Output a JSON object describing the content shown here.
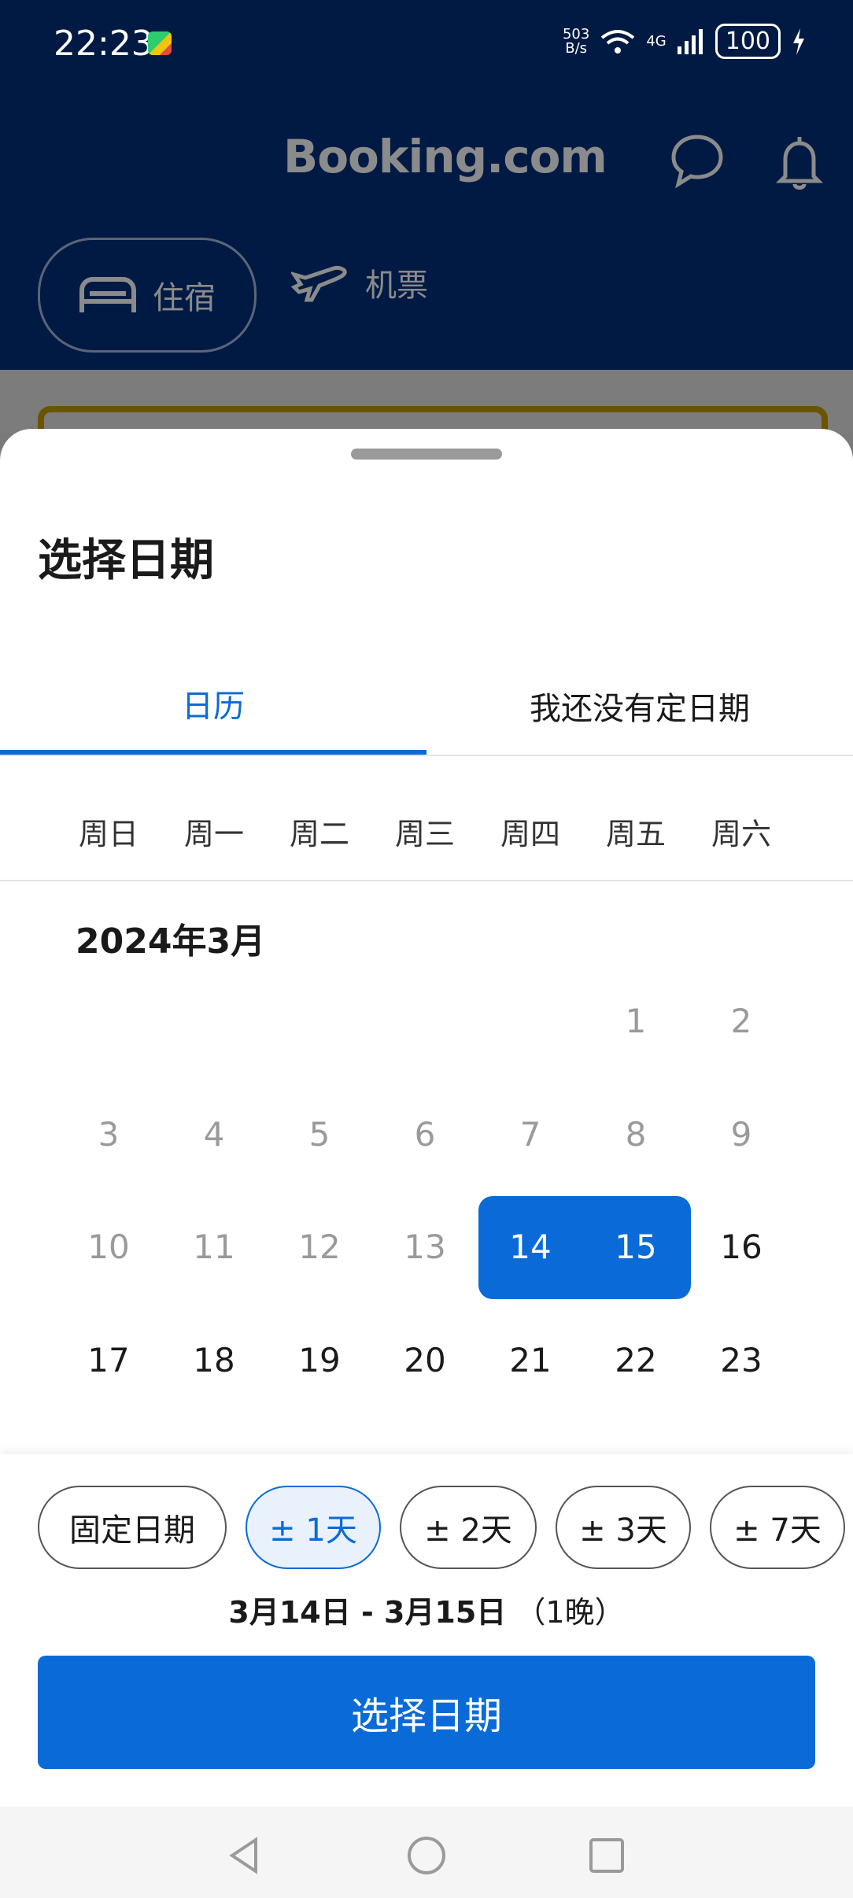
{
  "status": {
    "time": "22:23",
    "net_speed": "503\nB/s",
    "signal": "4G",
    "battery": "100"
  },
  "app": {
    "brand": "Booking.com"
  },
  "top_tabs": {
    "stay_label": "住宿",
    "flight_label": "机票"
  },
  "sheet": {
    "title": "选择日期",
    "tabs": {
      "calendar": "日历",
      "no_date": "我还没有定日期"
    },
    "weekdays": [
      "周日",
      "周一",
      "周二",
      "周三",
      "周四",
      "周五",
      "周六"
    ],
    "month_label": "2024年3月",
    "days": [
      "1",
      "2",
      "3",
      "4",
      "5",
      "6",
      "7",
      "8",
      "9",
      "10",
      "11",
      "12",
      "13",
      "14",
      "15",
      "16",
      "17",
      "18",
      "19",
      "20",
      "21",
      "22",
      "23"
    ],
    "selected_start": "14",
    "selected_end": "15"
  },
  "flex": {
    "chips": [
      "固定日期",
      "± 1天",
      "± 2天",
      "± 3天",
      "± 7天"
    ],
    "active_chip": "± 1天",
    "summary_dates": "3月14日 - 3月15日",
    "summary_nights": "（1晚）",
    "confirm_label": "选择日期"
  },
  "colors": {
    "brand_blue": "#0a6bd8",
    "header_navy": "#001a44"
  }
}
